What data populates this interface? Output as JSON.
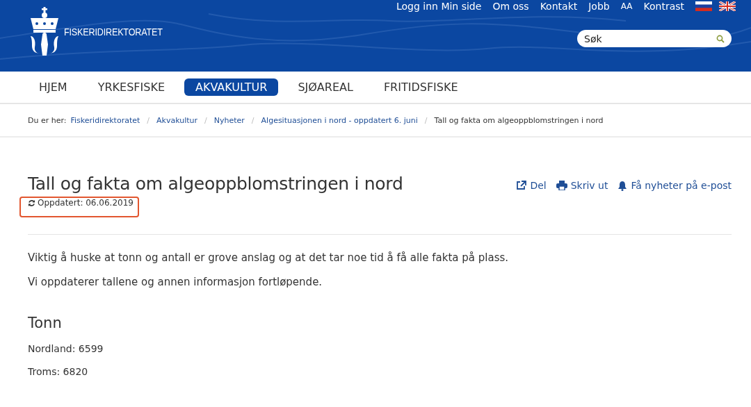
{
  "header": {
    "logo_text": "FISKERIDIREKTORATET",
    "top_links": [
      "Logg inn Min side",
      "Om oss",
      "Kontakt",
      "Jobb",
      "AA",
      "Kontrast"
    ],
    "search": {
      "placeholder": "Søk"
    }
  },
  "nav": [
    {
      "label": "HJEM",
      "selected": false
    },
    {
      "label": "YRKESFISKE",
      "selected": false
    },
    {
      "label": "AKVAKULTUR",
      "selected": true
    },
    {
      "label": "SJØAREAL",
      "selected": false
    },
    {
      "label": "FRITIDSFISKE",
      "selected": false
    }
  ],
  "breadcrumb": {
    "label": "Du er her:",
    "separator": "/",
    "links": [
      "Fiskeridirektoratet",
      "Akvakultur",
      "Nyheter",
      "Algesituasjonen i nord - oppdatert 6. juni"
    ],
    "current": "Tall og fakta om algeoppblomstringen i nord"
  },
  "article": {
    "title": "Tall og fakta om algeoppblomstringen i nord",
    "updated": "Oppdatert: 06.06.2019",
    "actions": [
      {
        "kind": "share",
        "label": "Del"
      },
      {
        "kind": "print",
        "label": "Skriv ut"
      },
      {
        "kind": "notify",
        "label": "Få nyheter på e-post"
      }
    ],
    "paragraphs": [
      "Viktig å huske at tonn og antall er grove anslag og at det tar noe tid å få alle fakta på plass.",
      "Vi oppdaterer tallene og annen informasjon fortløpende."
    ],
    "section_heading": "Tonn",
    "facts": [
      "Nordland: 6599",
      "Troms: 6820"
    ]
  }
}
